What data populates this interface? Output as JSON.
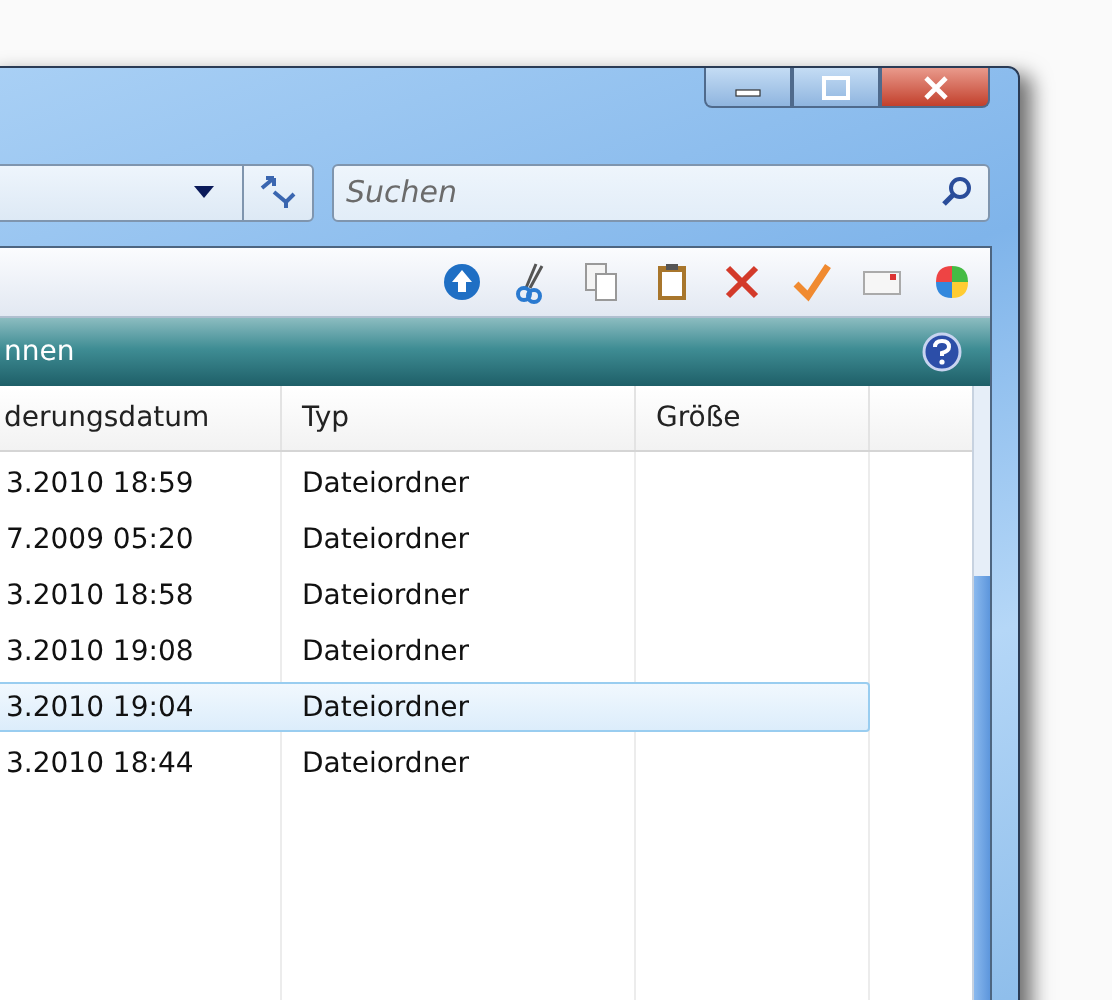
{
  "search": {
    "placeholder": "Suchen"
  },
  "toolbar": {
    "buttons": [
      {
        "kind": "up"
      },
      {
        "kind": "cut"
      },
      {
        "kind": "copy"
      },
      {
        "kind": "paste"
      },
      {
        "kind": "delete"
      },
      {
        "kind": "check"
      },
      {
        "kind": "mail"
      },
      {
        "kind": "windows"
      }
    ]
  },
  "header_bar": {
    "title": "nnen"
  },
  "table": {
    "columns": [
      "derungsdatum",
      "Typ",
      "Größe"
    ],
    "rows": [
      {
        "date": "3.2010 18:59",
        "type": "Dateiordner",
        "selected": false
      },
      {
        "date": "7.2009 05:20",
        "type": "Dateiordner",
        "selected": false
      },
      {
        "date": "3.2010 18:58",
        "type": "Dateiordner",
        "selected": false
      },
      {
        "date": "3.2010 19:08",
        "type": "Dateiordner",
        "selected": false
      },
      {
        "date": "3.2010 19:04",
        "type": "Dateiordner",
        "selected": true
      },
      {
        "date": "3.2010 18:44",
        "type": "Dateiordner",
        "selected": false
      }
    ]
  }
}
